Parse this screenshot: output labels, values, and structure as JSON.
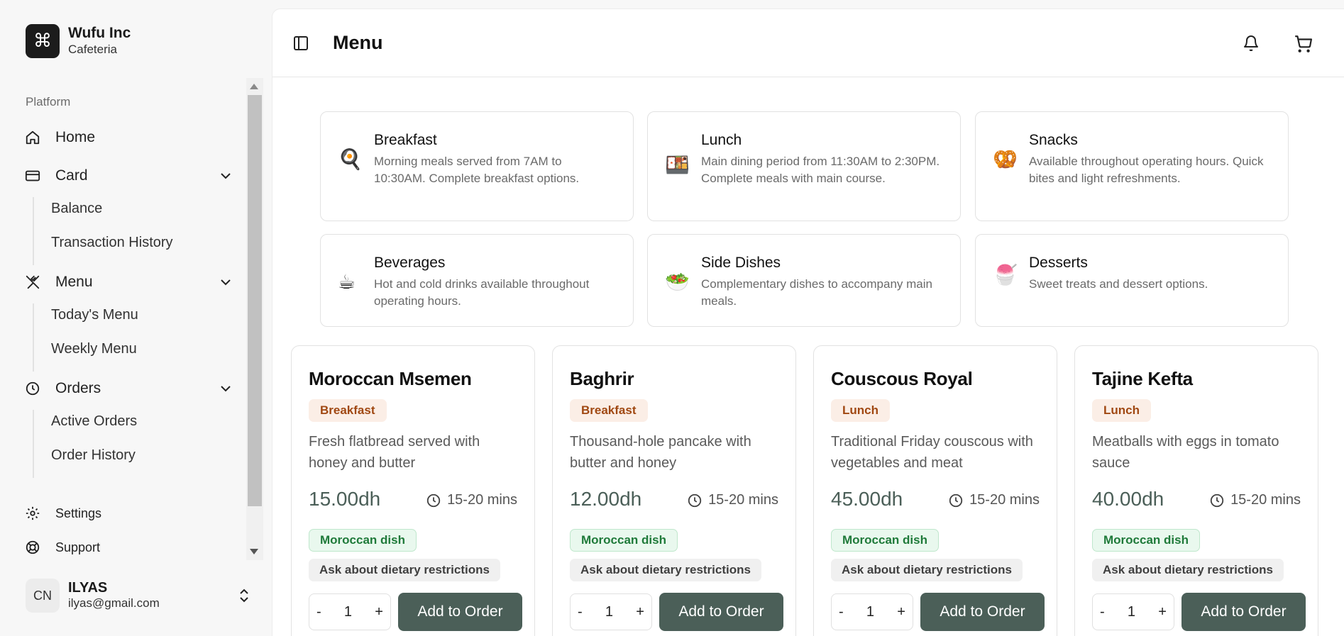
{
  "brand": {
    "name": "Wufu Inc",
    "subtitle": "Cafeteria",
    "logo_glyph": "⌘"
  },
  "sidebar": {
    "section_label": "Platform",
    "home": "Home",
    "card": {
      "label": "Card",
      "items": [
        "Balance",
        "Transaction History"
      ]
    },
    "menu": {
      "label": "Menu",
      "items": [
        "Today's Menu",
        "Weekly Menu"
      ]
    },
    "orders": {
      "label": "Orders",
      "items": [
        "Active Orders",
        "Order History"
      ]
    },
    "settings": "Settings",
    "support": "Support"
  },
  "user": {
    "initials": "CN",
    "name": "ILYAS",
    "email": "ilyas@gmail.com"
  },
  "header": {
    "title": "Menu"
  },
  "categories": [
    {
      "emoji": "🍳",
      "title": "Breakfast",
      "desc": "Morning meals served from 7AM to 10:30AM. Complete breakfast options."
    },
    {
      "emoji": "🍱",
      "title": "Lunch",
      "desc": "Main dining period from 11:30AM to 2:30PM. Complete meals with main course."
    },
    {
      "emoji": "🥨",
      "title": "Snacks",
      "desc": "Available throughout operating hours. Quick bites and light refreshments."
    },
    {
      "emoji": "☕",
      "title": "Beverages",
      "desc": "Hot and cold drinks available throughout operating hours."
    },
    {
      "emoji": "🥗",
      "title": "Side Dishes",
      "desc": "Complementary dishes to accompany main meals."
    },
    {
      "emoji": "🍧",
      "title": "Desserts",
      "desc": "Sweet treats and dessert options."
    }
  ],
  "items": [
    {
      "name": "Moroccan Msemen",
      "category": "Breakfast",
      "desc": "Fresh flatbread served with honey and butter",
      "price": "15.00dh",
      "time": "15-20 mins",
      "tag": "Moroccan dish",
      "note": "Ask about dietary restrictions",
      "qty": "1",
      "minus": "-",
      "plus": "+",
      "button": "Add to Order"
    },
    {
      "name": "Baghrir",
      "category": "Breakfast",
      "desc": "Thousand-hole pancake with butter and honey",
      "price": "12.00dh",
      "time": "15-20 mins",
      "tag": "Moroccan dish",
      "note": "Ask about dietary restrictions",
      "qty": "1",
      "minus": "-",
      "plus": "+",
      "button": "Add to Order"
    },
    {
      "name": "Couscous Royal",
      "category": "Lunch",
      "desc": "Traditional Friday couscous with vegetables and meat",
      "price": "45.00dh",
      "time": "15-20 mins",
      "tag": "Moroccan dish",
      "note": "Ask about dietary restrictions",
      "qty": "1",
      "minus": "-",
      "plus": "+",
      "button": "Add to Order"
    },
    {
      "name": "Tajine Kefta",
      "category": "Lunch",
      "desc": "Meatballs with eggs in tomato sauce",
      "price": "40.00dh",
      "time": "15-20 mins",
      "tag": "Moroccan dish",
      "note": "Ask about dietary restrictions",
      "qty": "1",
      "minus": "-",
      "plus": "+",
      "button": "Add to Order"
    }
  ],
  "colors": {
    "accent": "#4b5f58",
    "badge_bg": "#fbeee6",
    "badge_text": "#a04812",
    "tag_green": "#1f7a3a"
  }
}
